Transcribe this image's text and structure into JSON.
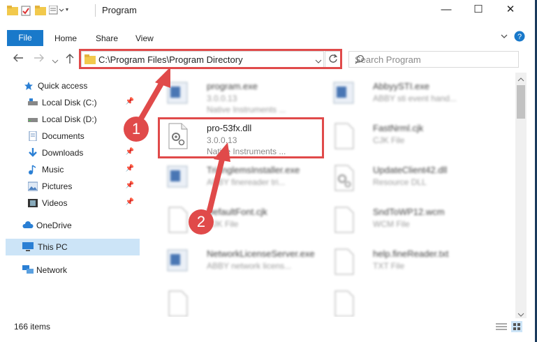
{
  "window": {
    "title": "Program",
    "minimize": "—",
    "maximize": "☐",
    "close": "✕"
  },
  "ribbon": {
    "file": "File",
    "tabs": [
      "Home",
      "Share",
      "View"
    ]
  },
  "address": {
    "path": "C:\\Program Files\\Program Directory",
    "search_placeholder": "Search Program"
  },
  "nav": {
    "items": [
      {
        "label": "Quick access",
        "icon": "star-icon"
      },
      {
        "label": "Local Disk (C:)",
        "icon": "drive-icon",
        "pinned": true
      },
      {
        "label": "Local Disk (D:)",
        "icon": "drive-icon"
      },
      {
        "label": "Documents",
        "icon": "documents-icon"
      },
      {
        "label": "Downloads",
        "icon": "downloads-icon",
        "pinned": true
      },
      {
        "label": "Music",
        "icon": "music-icon",
        "pinned": true
      },
      {
        "label": "Pictures",
        "icon": "pictures-icon",
        "pinned": true
      },
      {
        "label": "Videos",
        "icon": "videos-icon",
        "pinned": true
      },
      {
        "label": "OneDrive",
        "icon": "cloud-icon"
      },
      {
        "label": "This PC",
        "icon": "computer-icon",
        "selected": true
      },
      {
        "label": "Network",
        "icon": "network-icon"
      }
    ]
  },
  "files": {
    "f0": {
      "name": "program.exe",
      "meta1": "3.0.0.13",
      "meta2": "Native Instruments ..."
    },
    "f1": {
      "name": "AbbyySTI.exe",
      "meta1": "ABBY sti event hand..."
    },
    "f2": {
      "name": "pro-53fx.dll",
      "meta1": "3.0.0.13",
      "meta2": "Native Instruments ..."
    },
    "f3": {
      "name": "FastNrml.cjk",
      "meta1": "CJK File"
    },
    "f4": {
      "name": "TrianglemsInstaller.exe",
      "meta1": "ABBY finereader tri..."
    },
    "f5": {
      "name": "UpdateClient42.dll",
      "meta1": "Resource DLL"
    },
    "f6": {
      "name": "DefaultFont.cjk",
      "meta1": "CJK File"
    },
    "f7": {
      "name": "SndToWP12.wcm",
      "meta1": "WCM File"
    },
    "f8": {
      "name": "NetworkLicenseServer.exe",
      "meta1": "ABBY network licens..."
    },
    "f9": {
      "name": "help.fineReader.txt",
      "meta1": "TXT File"
    }
  },
  "status": {
    "items": "166 items"
  },
  "annotations": [
    "1",
    "2"
  ],
  "colors": {
    "accent": "#1979ca",
    "highlight": "#e04a4a"
  }
}
